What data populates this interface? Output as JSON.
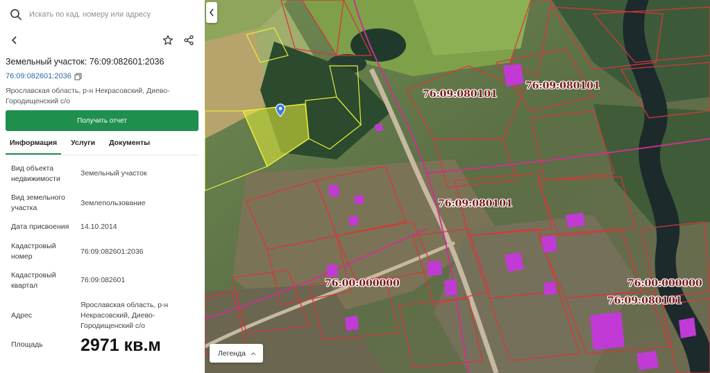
{
  "search": {
    "placeholder": "Искать по кад. номеру или адресу",
    "icon": "search-icon"
  },
  "header": {
    "back_icon": "arrow-left-icon",
    "favorite_icon": "star-icon",
    "share_icon": "share-icon"
  },
  "parcel": {
    "title": "Земельный участок: 76:09:082601:2036",
    "cad_number_link": "76:09:082601:2036",
    "address": "Ярославская область, р-н Некрасовский, Диево-Городищенский с/о"
  },
  "actions": {
    "report_label": "Получить отчет"
  },
  "tabs": [
    {
      "label": "Информация",
      "active": true
    },
    {
      "label": "Услуги",
      "active": false
    },
    {
      "label": "Документы",
      "active": false
    }
  ],
  "info_rows": [
    {
      "label": "Вид объекта недвижимости",
      "value": "Земельный участок"
    },
    {
      "label": "Вид земельного участка",
      "value": "Землепользование"
    },
    {
      "label": "Дата присвоения",
      "value": "14.10.2014"
    },
    {
      "label": "Кадастровый номер",
      "value": "76:09:082601:2036"
    },
    {
      "label": "Кадастровый квартал",
      "value": "76:09:082601"
    },
    {
      "label": "Адрес",
      "value": "Ярославская область, р-н Некрасовский, Диево-Городищенский с/о"
    },
    {
      "label": "Площадь",
      "value": "2971 кв.м"
    }
  ],
  "map": {
    "quarter_labels": [
      "76:09:080101",
      "76:09:080101",
      "76:09:080101",
      "76:00:000000",
      "76:00:000000",
      "76:09:080101"
    ],
    "legend_label": "Легенда",
    "collapse_icon": "chevron-left-icon"
  },
  "colors": {
    "accent": "#1f8f4e",
    "link": "#2d6aa8",
    "parcel_border": "#d8363a",
    "selected_parcel": "#e6ee3a",
    "building": "#c23ad6"
  }
}
